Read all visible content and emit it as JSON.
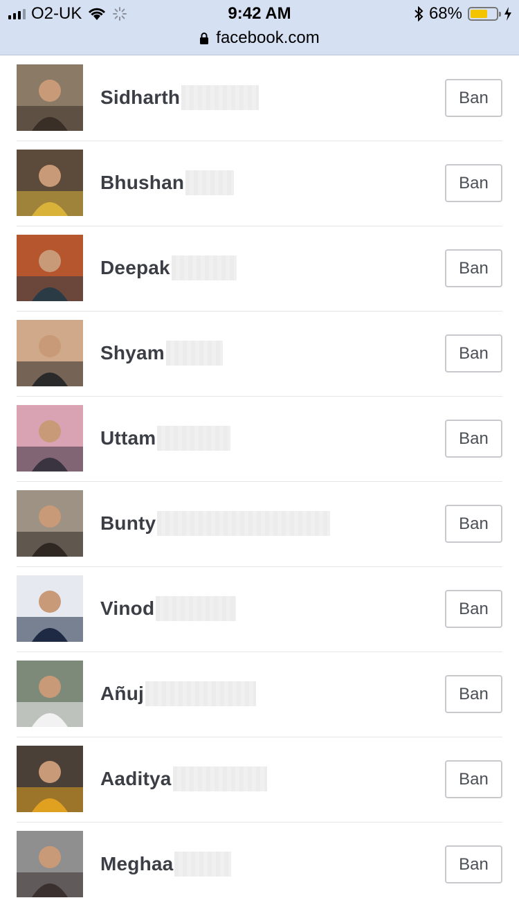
{
  "status_bar": {
    "carrier": "O2-UK",
    "time": "9:42 AM",
    "battery": "68%",
    "battery_level": 0.68,
    "battery_color": "#f5c400"
  },
  "browser": {
    "url": "facebook.com"
  },
  "members": [
    {
      "name": "Sidharth",
      "action": "Ban",
      "bg": "#8a7a66",
      "fg": "#3a2f27"
    },
    {
      "name": "Bhushan",
      "action": "Ban",
      "bg": "#5c4a3a",
      "fg": "#d9b23a"
    },
    {
      "name": "Deepak",
      "action": "Ban",
      "bg": "#b5562f",
      "fg": "#2b3b46"
    },
    {
      "name": "Shyam",
      "action": "Ban",
      "bg": "#cfa98a",
      "fg": "#2b2a2a"
    },
    {
      "name": "Uttam",
      "action": "Ban",
      "bg": "#d9a3b3",
      "fg": "#3a3340"
    },
    {
      "name": "Bunty",
      "action": "Ban",
      "bg": "#9e9284",
      "fg": "#2e2722"
    },
    {
      "name": "Vinod",
      "action": "Ban",
      "bg": "#e6eaf0",
      "fg": "#1e2a44"
    },
    {
      "name": "Añuj",
      "action": "Ban",
      "bg": "#7d8a7a",
      "fg": "#f2f2f2"
    },
    {
      "name": "Aaditya",
      "action": "Ban",
      "bg": "#4a4038",
      "fg": "#e0a020"
    },
    {
      "name": "Meghaa",
      "action": "Ban",
      "bg": "#8f8f8f",
      "fg": "#3a3030"
    }
  ]
}
